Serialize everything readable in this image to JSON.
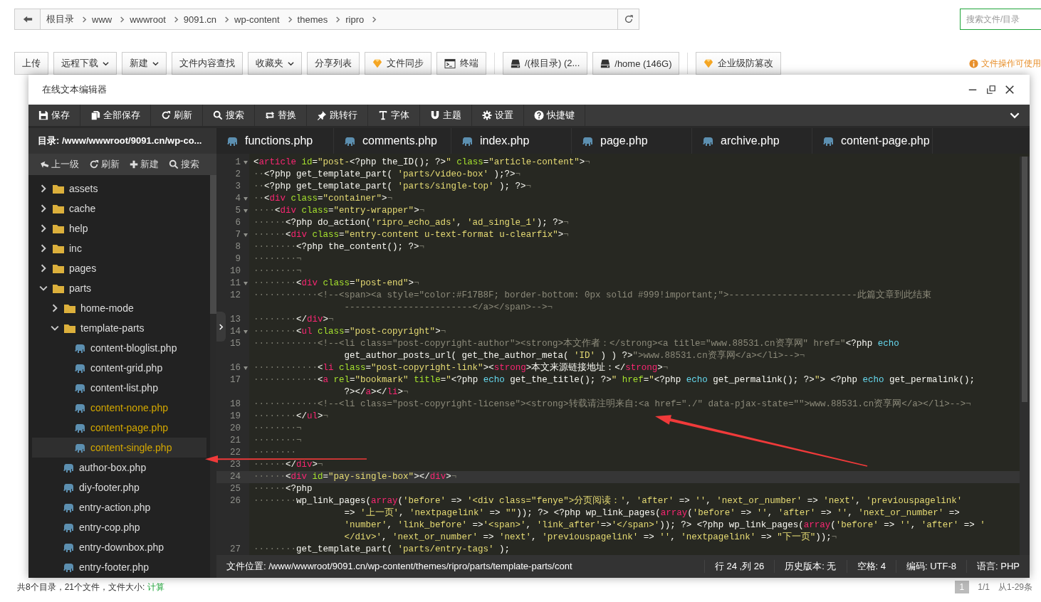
{
  "breadcrumb": {
    "items": [
      "根目录",
      "www",
      "wwwroot",
      "9091.cn",
      "wp-content",
      "themes",
      "ripro"
    ]
  },
  "search": {
    "placeholder": "搜索文件/目录"
  },
  "toolbar": {
    "buttons": [
      {
        "label": "上传",
        "kind": "plain",
        "separator_before": false
      },
      {
        "label": "远程下载",
        "kind": "dropdown",
        "separator_before": false
      },
      {
        "label": "新建",
        "kind": "dropdown",
        "separator_before": false
      },
      {
        "label": "文件内容查找",
        "kind": "plain",
        "separator_before": false
      },
      {
        "label": "收藏夹",
        "kind": "dropdown",
        "separator_before": false
      },
      {
        "label": "分享列表",
        "kind": "plain",
        "separator_before": false
      },
      {
        "label": "文件同步",
        "kind": "plain",
        "separator_before": false
      },
      {
        "label": "终端",
        "kind": "plain",
        "separator_before": false
      },
      {
        "label": "/(根目录) (2...",
        "kind": "plain",
        "separator_before": true
      },
      {
        "label": "/home (146G)",
        "kind": "plain",
        "separator_before": false
      },
      {
        "label": "企业级防篡改",
        "kind": "plain",
        "separator_before": true
      }
    ],
    "notice": "文件操作可使用"
  },
  "editor": {
    "title": "在线文本编辑器",
    "actions": [
      "保存",
      "全部保存",
      "刷新",
      "搜索",
      "替换",
      "跳转行",
      "字体",
      "主题",
      "设置",
      "快捷键"
    ],
    "sidebar": {
      "path": "目录: /www/wwwroot/9091.cn/wp-co...",
      "actions": [
        "上一级",
        "刷新",
        "新建",
        "搜索"
      ],
      "tree": [
        {
          "name": "assets",
          "kind": "folder",
          "expanded": false,
          "selected": false
        },
        {
          "name": "cache",
          "kind": "folder",
          "expanded": false,
          "selected": false
        },
        {
          "name": "help",
          "kind": "folder",
          "expanded": false,
          "selected": false
        },
        {
          "name": "inc",
          "kind": "folder",
          "expanded": false,
          "selected": false
        },
        {
          "name": "pages",
          "kind": "folder",
          "expanded": false,
          "selected": false
        },
        {
          "name": "parts",
          "kind": "folder",
          "expanded": true,
          "selected": false,
          "children": [
            {
              "name": "home-mode",
              "kind": "folder",
              "expanded": false,
              "selected": false
            },
            {
              "name": "template-parts",
              "kind": "folder",
              "expanded": true,
              "selected": false,
              "children": [
                {
                  "name": "content-bloglist.php",
                  "kind": "file",
                  "color": "#dddddd",
                  "selected": false
                },
                {
                  "name": "content-grid.php",
                  "kind": "file",
                  "color": "#dddddd",
                  "selected": false
                },
                {
                  "name": "content-list.php",
                  "kind": "file",
                  "color": "#dddddd",
                  "selected": false
                },
                {
                  "name": "content-none.php",
                  "kind": "file",
                  "color": "#d4a800",
                  "selected": false
                },
                {
                  "name": "content-page.php",
                  "kind": "file",
                  "color": "#d4a800",
                  "selected": false
                },
                {
                  "name": "content-single.php",
                  "kind": "file",
                  "color": "#d4a800",
                  "selected": true
                }
              ]
            },
            {
              "name": "author-box.php",
              "kind": "file",
              "color": "#dddddd",
              "selected": false
            },
            {
              "name": "diy-footer.php",
              "kind": "file",
              "color": "#dddddd",
              "selected": false
            },
            {
              "name": "entry-action.php",
              "kind": "file",
              "color": "#dddddd",
              "selected": false
            },
            {
              "name": "entry-cop.php",
              "kind": "file",
              "color": "#dddddd",
              "selected": false
            },
            {
              "name": "entry-downbox.php",
              "kind": "file",
              "color": "#dddddd",
              "selected": false
            },
            {
              "name": "entry-footer.php",
              "kind": "file",
              "color": "#dddddd",
              "selected": false
            }
          ]
        }
      ]
    },
    "tabs": [
      "functions.php",
      "comments.php",
      "index.php",
      "page.php",
      "archive.php",
      "content-page.php"
    ],
    "code": {
      "rows": [
        {
          "kind": "line",
          "number": "1",
          "fold": true,
          "active": false,
          "text": "<article id=\"post-<?php the_ID(); ?>\" class=\"article-content\">¬"
        },
        {
          "kind": "line",
          "number": "2",
          "fold": false,
          "active": false,
          "text": "··<?php get_template_part( 'parts/video-box' );?>¬"
        },
        {
          "kind": "line",
          "number": "3",
          "fold": false,
          "active": false,
          "text": "··<?php get_template_part( 'parts/single-top' ); ?>¬"
        },
        {
          "kind": "line",
          "number": "4",
          "fold": true,
          "active": false,
          "text": "··<div class=\"container\">¬"
        },
        {
          "kind": "line",
          "number": "5",
          "fold": true,
          "active": false,
          "text": "····<div class=\"entry-wrapper\">¬"
        },
        {
          "kind": "line",
          "number": "6",
          "fold": false,
          "active": false,
          "text": "······<?php do_action('ripro_echo_ads', 'ad_single_1'); ?>¬"
        },
        {
          "kind": "line",
          "number": "7",
          "fold": true,
          "active": false,
          "text": "······<div class=\"entry-content u-text-format u-clearfix\">¬"
        },
        {
          "kind": "line",
          "number": "8",
          "fold": false,
          "active": false,
          "text": "········<?php the_content(); ?>¬"
        },
        {
          "kind": "line",
          "number": "9",
          "fold": false,
          "active": false,
          "text": "········¬"
        },
        {
          "kind": "line",
          "number": "10",
          "fold": false,
          "active": false,
          "text": "········¬"
        },
        {
          "kind": "line",
          "number": "11",
          "fold": true,
          "active": false,
          "text": "········<div class=\"post-end\">¬"
        },
        {
          "kind": "line",
          "number": "12",
          "fold": false,
          "active": false,
          "text": "············<!--<span><a style=\"color:#F17B8F; border-bottom: 0px solid #999!important;\">------------------------此篇文章到此结束"
        },
        {
          "kind": "wrap",
          "text": "------------------------</a></span>-->¬"
        },
        {
          "kind": "line",
          "number": "13",
          "fold": false,
          "active": false,
          "text": "········</div>¬"
        },
        {
          "kind": "line",
          "number": "14",
          "fold": true,
          "active": false,
          "text": "········<ul class=\"post-copyright\">¬"
        },
        {
          "kind": "line",
          "number": "15",
          "fold": false,
          "active": false,
          "text": "············<!--<li class=\"post-copyright-author\"><strong>本文作者：</strong><a title=\"www.88531.cn资享网\" href=\"<?php echo"
        },
        {
          "kind": "wrap",
          "text": "get_author_posts_url( get_the_author_meta( 'ID' ) ) ?>\">www.88531.cn资享网</a></li>-->¬"
        },
        {
          "kind": "line",
          "number": "16",
          "fold": true,
          "active": false,
          "text": "············<li class=\"post-copyright-link\"><strong>本文来源链接地址：</strong>¬"
        },
        {
          "kind": "line",
          "number": "17",
          "fold": false,
          "active": false,
          "text": "············<a rel=\"bookmark\" title=\"<?php echo get_the_title(); ?>\" href=\"<?php echo get_permalink(); ?>\"> <?php echo get_permalink();"
        },
        {
          "kind": "wrap",
          "text": "?></a></li>¬"
        },
        {
          "kind": "line",
          "number": "18",
          "fold": false,
          "active": false,
          "text": "············<!--<li class=\"post-copyright-license\"><strong>转载请注明来自:<a href=\"./\" data-pjax-state=\"\">www.88531.cn资享网</a></li>-->¬"
        },
        {
          "kind": "line",
          "number": "19",
          "fold": false,
          "active": false,
          "text": "········</ul>¬"
        },
        {
          "kind": "line",
          "number": "20",
          "fold": false,
          "active": false,
          "text": "········¬"
        },
        {
          "kind": "line",
          "number": "21",
          "fold": false,
          "active": false,
          "text": "········¬"
        },
        {
          "kind": "line",
          "number": "22",
          "fold": false,
          "active": false,
          "text": "········"
        },
        {
          "kind": "line",
          "number": "23",
          "fold": false,
          "active": false,
          "text": "······</div>¬"
        },
        {
          "kind": "line",
          "number": "24",
          "fold": false,
          "active": true,
          "text": "······<div id=\"pay-single-box\"></div>¬"
        },
        {
          "kind": "line",
          "number": "25",
          "fold": false,
          "active": false,
          "text": "······<?php"
        },
        {
          "kind": "line",
          "number": "26",
          "fold": false,
          "active": false,
          "text": "········wp_link_pages(array('before' => '<div class=\"fenye\">分页阅读：', 'after' => '', 'next_or_number' => 'next', 'previouspagelink'"
        },
        {
          "kind": "wrap",
          "text": "=> '上一页', 'nextpagelink' => \"\")); ?> <?php wp_link_pages(array('before' => '', 'after' => '', 'next_or_number' =>"
        },
        {
          "kind": "wrap",
          "text": "'number', 'link_before' =>'<span>', 'link_after'=>'</span>')); ?> <?php wp_link_pages(array('before' => '', 'after' => '"
        },
        {
          "kind": "wrap",
          "text": "</div>', 'next_or_number' => 'next', 'previouspagelink' => '', 'nextpagelink' => \"下一页\"));¬"
        },
        {
          "kind": "line",
          "number": "27",
          "fold": false,
          "active": false,
          "text": "········get_template_part( 'parts/entry-tags' );"
        }
      ]
    },
    "status": {
      "location": "文件位置: /www/wwwroot/9091.cn/wp-content/themes/ripro/parts/template-parts/cont",
      "cursor": "行 24 ,列 26",
      "history": "历史版本: 无",
      "spaces": "空格: 4",
      "encoding": "编码: UTF-8",
      "language": "语言: PHP"
    }
  },
  "footer": {
    "summary": "共8个目录，21个文件，文件大小: ",
    "summary_link": "计算",
    "pagination": [
      "1",
      "1/1",
      "从1-29条"
    ]
  }
}
